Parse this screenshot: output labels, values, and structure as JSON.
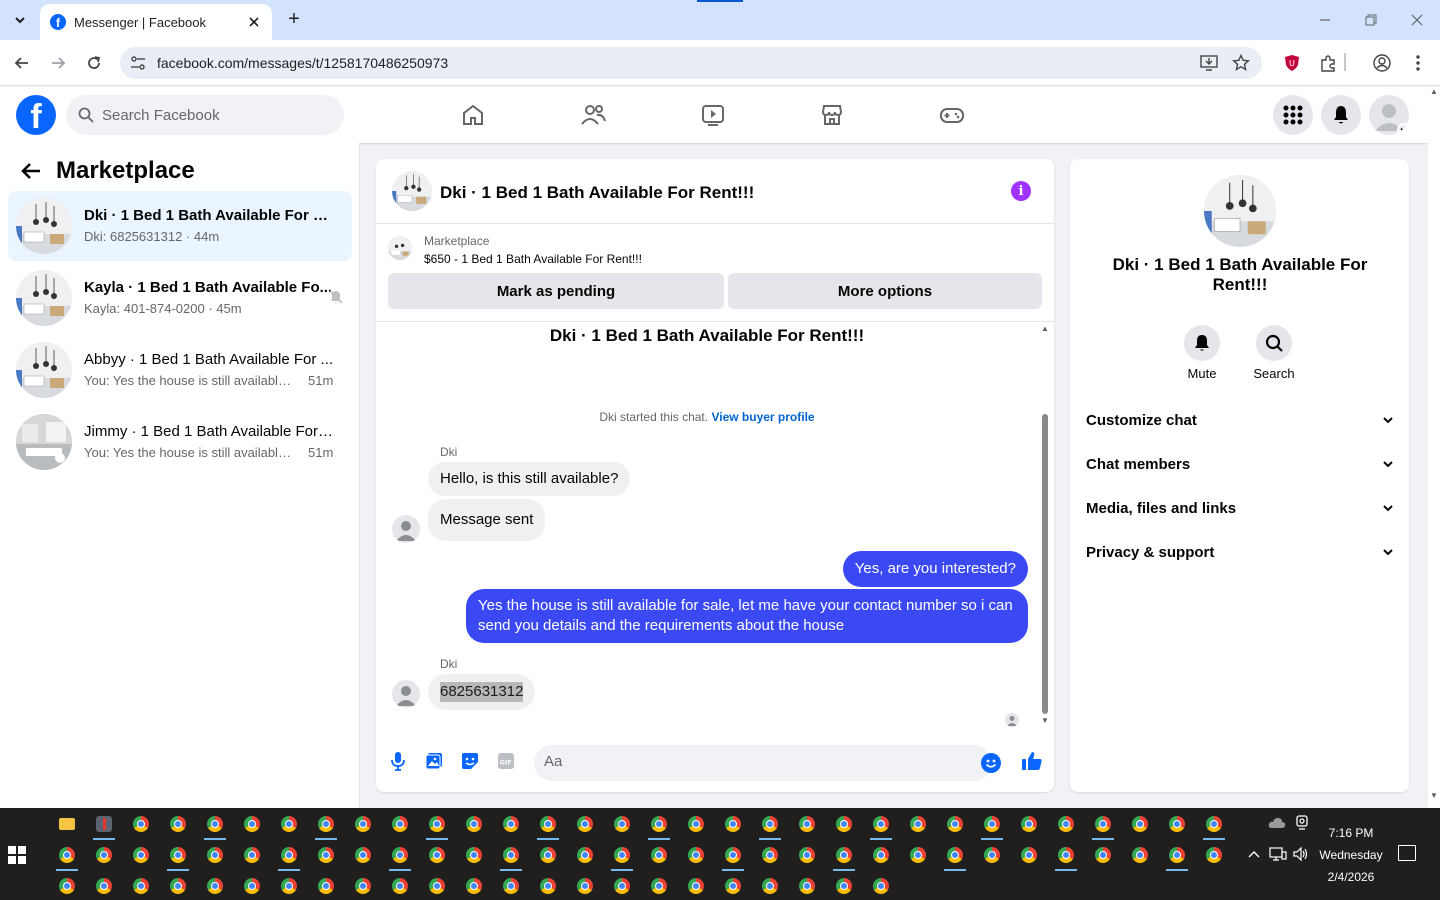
{
  "browser": {
    "tab_title": "Messenger | Facebook",
    "url": "facebook.com/messages/t/1258170486250973"
  },
  "fb_header": {
    "search_placeholder": "Search Facebook"
  },
  "sidebar": {
    "title": "Marketplace",
    "conversations": [
      {
        "name": "Dki · 1 Bed 1 Bath Available For Re...",
        "preview": "Dki: 6825631312",
        "time": "44m",
        "active": true,
        "bold": true
      },
      {
        "name": "Kayla · 1 Bed 1 Bath Available Fo...",
        "preview": "Kayla: 401-874-0200",
        "time": "45m",
        "active": false,
        "bold": true,
        "muted": true
      },
      {
        "name": "Abbyy · 1 Bed 1 Bath Available For ...",
        "preview": "You: Yes the house is still available f...",
        "time": "51m",
        "active": false,
        "bold": false
      },
      {
        "name": "Jimmy · 1 Bed 1 Bath Available For ...",
        "preview": "You: Yes the house is still available f...",
        "time": "51m",
        "active": false,
        "bold": false
      }
    ]
  },
  "chat": {
    "title": "Dki · 1 Bed 1 Bath Available For Rent!!!",
    "marketplace": {
      "label": "Marketplace",
      "listing": "$650 - 1 Bed 1 Bath Available For Rent!!!",
      "btn_pending": "Mark as pending",
      "btn_more": "More options"
    },
    "thread_title": "Dki · 1 Bed 1 Bath Available For Rent!!!",
    "started_text": "Dki started this chat.",
    "started_link": "View buyer profile",
    "messages": [
      {
        "sender": "Dki",
        "text": "Hello, is this still available?"
      },
      {
        "sender": "Dki",
        "text": "Message sent"
      },
      {
        "sender": "You",
        "text": "Yes, are you interested?"
      },
      {
        "sender": "You",
        "text_line1": "Yes the house is still available for sale, let me have your contact number so i can",
        "text_line2": "send you details and the requirements about the house"
      },
      {
        "sender": "Dki",
        "text": "6825631312"
      }
    ],
    "composer_placeholder": "Aa"
  },
  "details": {
    "name": "Dki · 1 Bed 1 Bath Available For Rent!!!",
    "actions": [
      {
        "label": "Mute",
        "icon": "bell-icon"
      },
      {
        "label": "Search",
        "icon": "search-icon"
      }
    ],
    "sections": [
      "Customize chat",
      "Chat members",
      "Media, files and links",
      "Privacy & support"
    ]
  },
  "taskbar": {
    "time": "7:16 PM",
    "day": "Wednesday",
    "date": "2/4/2026"
  },
  "colors": {
    "fb_blue": "#0866ff",
    "outgoing_bubble": "#3b49f5",
    "active_conversation": "#ebf5ff",
    "info_icon": "#a033ff"
  }
}
